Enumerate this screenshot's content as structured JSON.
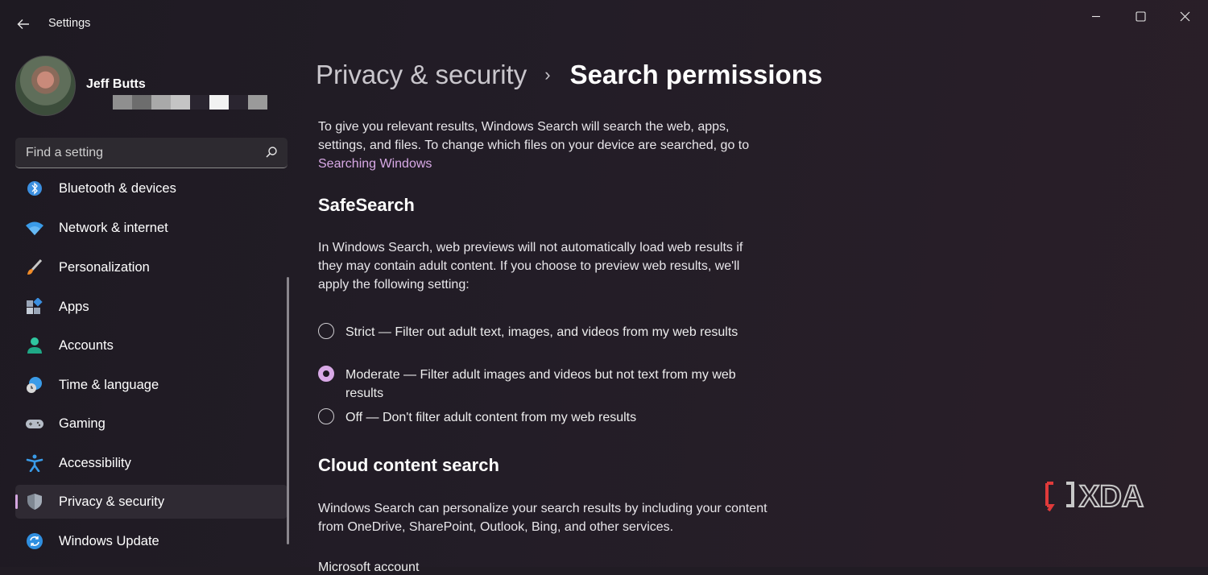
{
  "window": {
    "title": "Settings",
    "back_icon": "arrow-left-icon",
    "controls": [
      "minimize-icon",
      "maximize-icon",
      "close-icon"
    ]
  },
  "profile": {
    "name": "Jeff Butts",
    "redacted_colors": [
      "#8f8f8f",
      "#6d6d6d",
      "#a9a9a9",
      "#c4c4c4",
      "#2a2530",
      "#f2f2f2",
      "#2a2530",
      "#9a9a9a"
    ]
  },
  "search": {
    "placeholder": "Find a setting",
    "icon": "search-icon"
  },
  "sidebar": {
    "items": [
      {
        "label": "Bluetooth & devices",
        "icon": "bluetooth-icon",
        "selected": false
      },
      {
        "label": "Network & internet",
        "icon": "wifi-icon",
        "selected": false
      },
      {
        "label": "Personalization",
        "icon": "brush-icon",
        "selected": false
      },
      {
        "label": "Apps",
        "icon": "apps-icon",
        "selected": false
      },
      {
        "label": "Accounts",
        "icon": "person-icon",
        "selected": false
      },
      {
        "label": "Time & language",
        "icon": "globe-clock-icon",
        "selected": false
      },
      {
        "label": "Gaming",
        "icon": "gamepad-icon",
        "selected": false
      },
      {
        "label": "Accessibility",
        "icon": "accessibility-icon",
        "selected": false
      },
      {
        "label": "Privacy & security",
        "icon": "shield-icon",
        "selected": true
      },
      {
        "label": "Windows Update",
        "icon": "sync-icon",
        "selected": false
      }
    ]
  },
  "breadcrumb": {
    "parent": "Privacy & security",
    "separator": "›",
    "current": "Search permissions"
  },
  "intro": {
    "text": "To give you relevant results, Windows Search will search the web, apps, settings, and files. To change which files on your device are searched, go to ",
    "link": "Searching Windows"
  },
  "safesearch": {
    "title": "SafeSearch",
    "description": "In Windows Search, web previews will not automatically load web results if they may contain adult content. If you choose to preview web results, we'll apply the following setting:",
    "selected": "moderate",
    "options": [
      {
        "id": "strict",
        "label": "Strict — Filter out adult text, images, and videos from my web results"
      },
      {
        "id": "moderate",
        "label": "Moderate — Filter adult images and videos but not text from my web results"
      },
      {
        "id": "off",
        "label": "Off — Don't filter adult content from my web results"
      }
    ]
  },
  "cloud": {
    "title": "Cloud content search",
    "description": "Windows Search can personalize your search results by including your content from OneDrive, SharePoint, Outlook, Bing, and other services.",
    "next_label": "Microsoft account"
  },
  "watermark": {
    "text": "XDA",
    "icon": "xda-logo-icon"
  },
  "colors": {
    "accent": "#d8a9e6",
    "background": "#211c24",
    "sidebar_selected": "#2f2a33"
  }
}
